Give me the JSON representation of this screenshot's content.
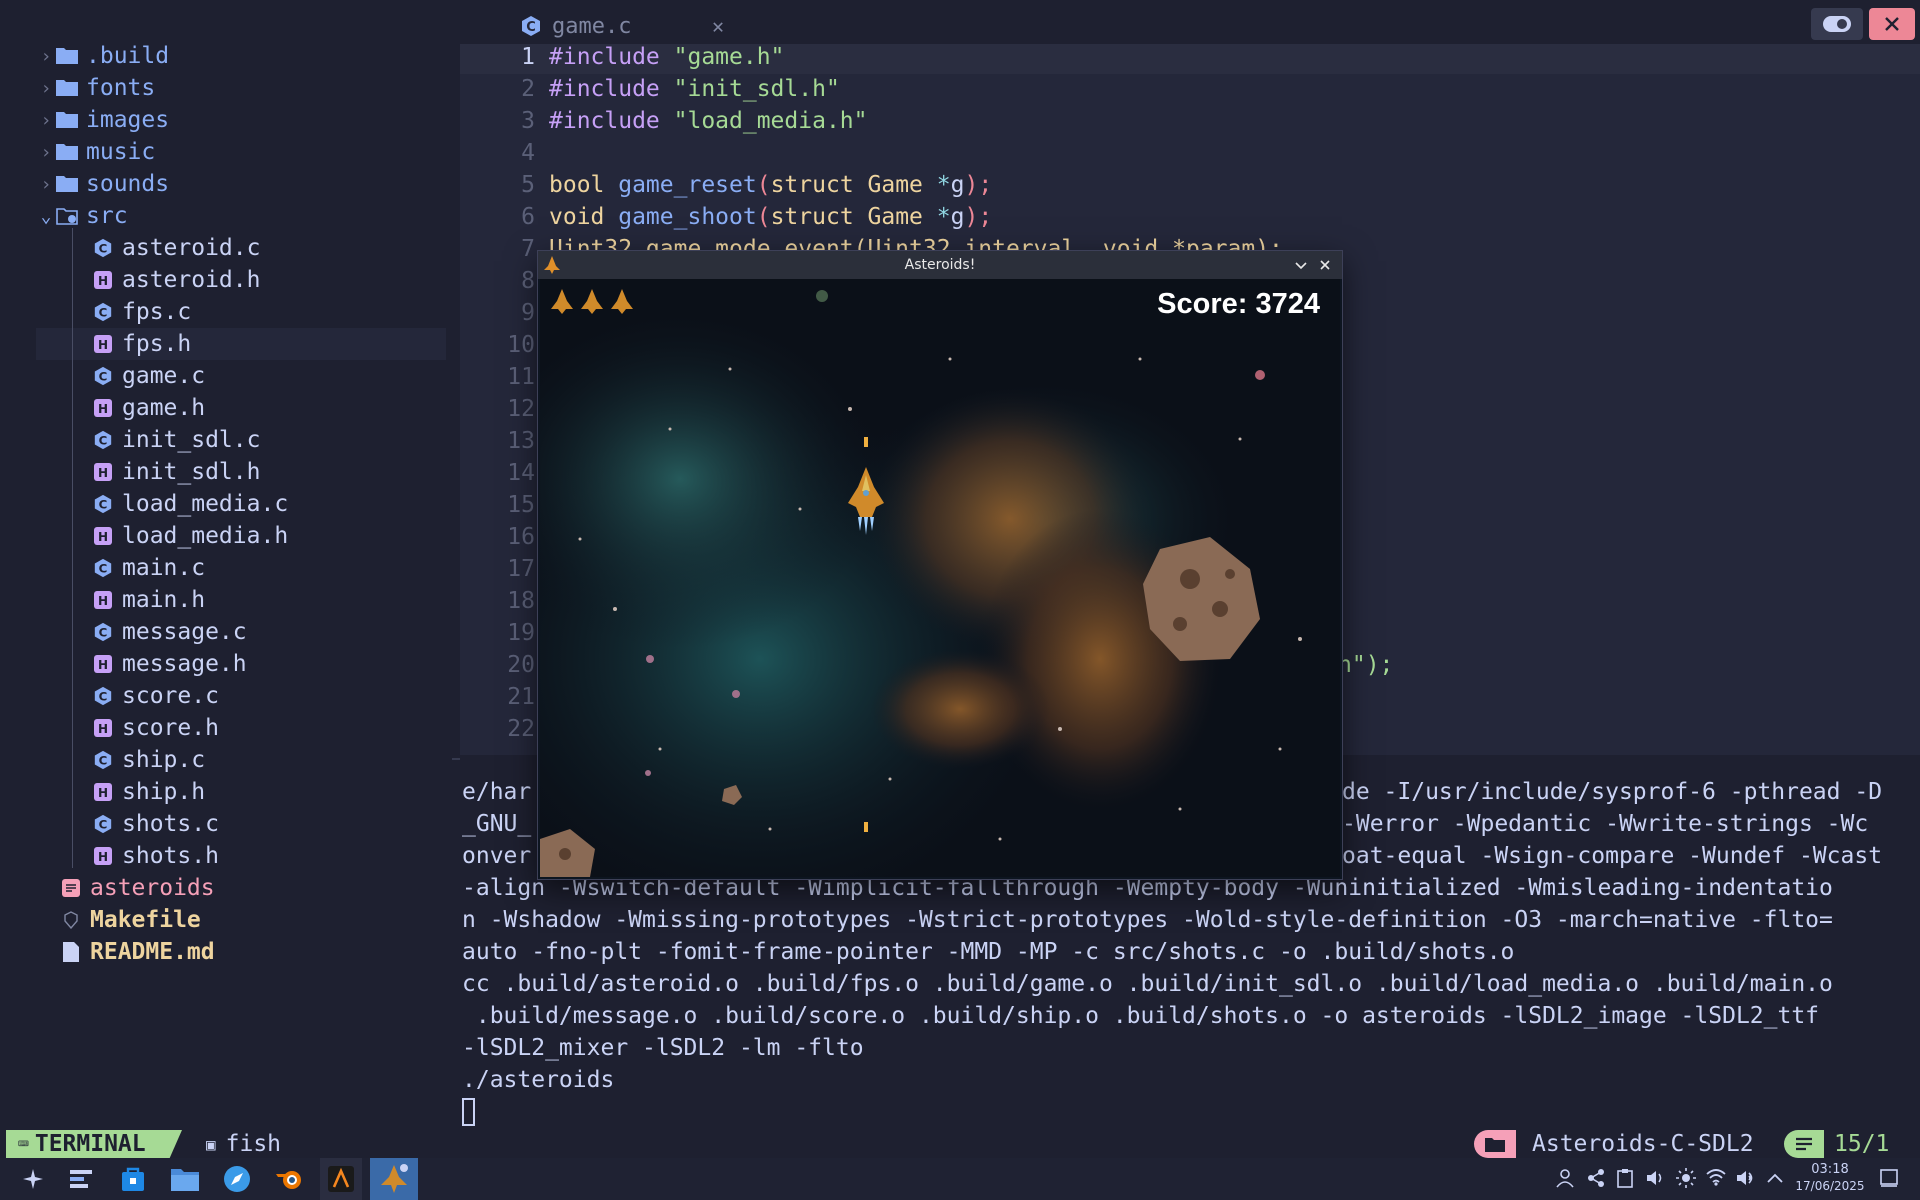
{
  "tree": {
    "items": [
      {
        "name": ".build",
        "kind": "folder",
        "expanded": false
      },
      {
        "name": "fonts",
        "kind": "folder",
        "expanded": false
      },
      {
        "name": "images",
        "kind": "folder",
        "expanded": false
      },
      {
        "name": "music",
        "kind": "folder",
        "expanded": false
      },
      {
        "name": "sounds",
        "kind": "folder",
        "expanded": false
      },
      {
        "name": "src",
        "kind": "folder",
        "expanded": true
      },
      {
        "name": "asteroid.c",
        "kind": "c"
      },
      {
        "name": "asteroid.h",
        "kind": "h"
      },
      {
        "name": "fps.c",
        "kind": "c"
      },
      {
        "name": "fps.h",
        "kind": "h"
      },
      {
        "name": "game.c",
        "kind": "c"
      },
      {
        "name": "game.h",
        "kind": "h"
      },
      {
        "name": "init_sdl.c",
        "kind": "c"
      },
      {
        "name": "init_sdl.h",
        "kind": "h"
      },
      {
        "name": "load_media.c",
        "kind": "c"
      },
      {
        "name": "load_media.h",
        "kind": "h"
      },
      {
        "name": "main.c",
        "kind": "c"
      },
      {
        "name": "main.h",
        "kind": "h"
      },
      {
        "name": "message.c",
        "kind": "c"
      },
      {
        "name": "message.h",
        "kind": "h"
      },
      {
        "name": "score.c",
        "kind": "c"
      },
      {
        "name": "score.h",
        "kind": "h"
      },
      {
        "name": "ship.c",
        "kind": "c"
      },
      {
        "name": "ship.h",
        "kind": "h"
      },
      {
        "name": "shots.c",
        "kind": "c"
      },
      {
        "name": "shots.h",
        "kind": "h"
      },
      {
        "name": "asteroids",
        "kind": "binary"
      },
      {
        "name": "Makefile",
        "kind": "makefile"
      },
      {
        "name": "README.md",
        "kind": "readme"
      }
    ]
  },
  "editor": {
    "tab_label": "game.c",
    "tab_close": "✕",
    "line_numbers": [
      "1",
      "2",
      "3",
      "4",
      "5",
      "6",
      "7",
      "8",
      "9",
      "10",
      "11",
      "12",
      "13",
      "14",
      "15",
      "16",
      "17",
      "18",
      "19",
      "20",
      "21",
      "22"
    ],
    "lines": {
      "l1": {
        "pre": "#include",
        "str": " \"game.h\""
      },
      "l2": {
        "pre": "#include",
        "str": " \"init_sdl.h\""
      },
      "l3": {
        "pre": "#include",
        "str": " \"load_media.h\""
      },
      "l5": {
        "ty": "bool",
        "fn": " game_reset",
        "a": "(",
        "b": "struct",
        "c": " Game ",
        "d": "*",
        "e": "g",
        "f": ");"
      },
      "l6": {
        "ty": "void",
        "fn": " game_shoot",
        "a": "(",
        "b": "struct",
        "c": " Game ",
        "d": "*",
        "e": "g",
        "f": ");"
      },
      "l7": {
        "text": "Uint32 game_mode_event(Uint32 interval, void *param);"
      },
      "l20_tail": "n\");"
    }
  },
  "terminal": {
    "lines": [
      "e/har",
      "_GNU_",
      "onver",
      "-align -Wswitch-default -Wimplicit-fallthrough -Wempty-body -Wuninitialized -Wmisleading-indentatio",
      "n -Wshadow -Wmissing-prototypes -Wstrict-prototypes -Wold-style-definition -O3 -march=native -flto=",
      "auto -fno-plt -fomit-frame-pointer -MMD -MP -c src/shots.c -o .build/shots.o",
      "cc .build/asteroid.o .build/fps.o .build/game.o .build/init_sdl.o .build/load_media.o .build/main.o",
      " .build/message.o .build/score.o .build/ship.o .build/shots.o -o asteroids -lSDL2_image -lSDL2_ttf",
      "-lSDL2_mixer -lSDL2 -lm -flto",
      "./asteroids"
    ],
    "right_fragments": [
      "de -I/usr/include/sysprof-6 -pthread -D",
      "-Werror -Wpedantic -Wwrite-strings -Wc",
      "oat-equal -Wsign-compare -Wundef -Wcast"
    ]
  },
  "game": {
    "title": "Asteroids!",
    "score_label": "Score: 3724",
    "lives": 3
  },
  "status": {
    "mode": "TERMINAL",
    "shell": "fish",
    "project": "Asteroids-C-SDL2",
    "position": "15/1"
  },
  "taskbar": {
    "time": "03:18",
    "date": "17/06/2025"
  },
  "colors": {
    "bg": "#1e2030",
    "editor_bg": "#24273a",
    "folder": "#8aadf4",
    "c_icon": "#8aadf4",
    "h_icon": "#c6a0f6",
    "status_green": "#a6da95",
    "close_red": "#ed8796"
  }
}
